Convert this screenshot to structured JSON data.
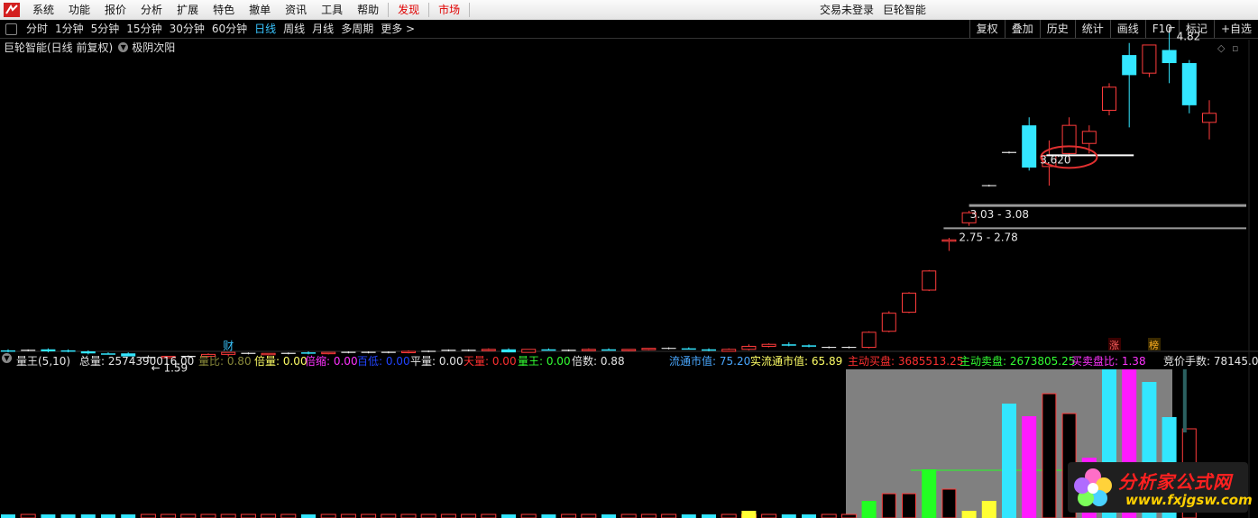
{
  "menu": {
    "items": [
      "系统",
      "功能",
      "报价",
      "分析",
      "扩展",
      "特色",
      "撤单",
      "资讯",
      "工具",
      "帮助"
    ],
    "discover": "发现",
    "market": "市场",
    "login_status": "交易未登录",
    "app_name": "巨轮智能"
  },
  "toolbar": {
    "periods": [
      "分时",
      "1分钟",
      "5分钟",
      "15分钟",
      "30分钟",
      "60分钟",
      "日线",
      "周线",
      "月线",
      "多周期",
      "更多 >"
    ],
    "active_period": "日线",
    "right_buttons": [
      "复权",
      "叠加",
      "历史",
      "统计",
      "画线",
      "F10",
      "标记",
      "+自选"
    ]
  },
  "chart_header": {
    "stock_name": "巨轮智能(日线 前复权)",
    "indicator": "极阴次阳"
  },
  "chart_data": {
    "type": "candlestick",
    "annotations": {
      "high_label": "4.82",
      "low_label": "1.59",
      "circled_label": "3.620",
      "zone_upper": "3.03 - 3.08",
      "zone_lower": "2.75 - 2.78",
      "finance_marker": "财",
      "limit_up_marker": "涨",
      "rank_marker": "榜"
    },
    "ohlc": [
      {
        "o": 1.66,
        "h": 1.67,
        "l": 1.64,
        "c": 1.65
      },
      {
        "o": 1.66,
        "h": 1.67,
        "l": 1.65,
        "c": 1.66
      },
      {
        "o": 1.67,
        "h": 1.68,
        "l": 1.64,
        "c": 1.65
      },
      {
        "o": 1.66,
        "h": 1.67,
        "l": 1.64,
        "c": 1.65
      },
      {
        "o": 1.65,
        "h": 1.66,
        "l": 1.62,
        "c": 1.63
      },
      {
        "o": 1.63,
        "h": 1.64,
        "l": 1.62,
        "c": 1.62
      },
      {
        "o": 1.63,
        "h": 1.64,
        "l": 1.6,
        "c": 1.6
      },
      {
        "o": 1.59,
        "h": 1.61,
        "l": 1.59,
        "c": 1.59
      },
      {
        "o": 1.59,
        "h": 1.6,
        "l": 1.59,
        "c": 1.6
      },
      {
        "o": 1.6,
        "h": 1.61,
        "l": 1.59,
        "c": 1.6
      },
      {
        "o": 1.6,
        "h": 1.63,
        "l": 1.59,
        "c": 1.62
      },
      {
        "o": 1.62,
        "h": 1.64,
        "l": 1.6,
        "c": 1.64
      },
      {
        "o": 1.63,
        "h": 1.64,
        "l": 1.62,
        "c": 1.63
      },
      {
        "o": 1.62,
        "h": 1.63,
        "l": 1.61,
        "c": 1.63
      },
      {
        "o": 1.63,
        "h": 1.64,
        "l": 1.62,
        "c": 1.63
      },
      {
        "o": 1.64,
        "h": 1.65,
        "l": 1.62,
        "c": 1.63
      },
      {
        "o": 1.63,
        "h": 1.64,
        "l": 1.62,
        "c": 1.64
      },
      {
        "o": 1.64,
        "h": 1.65,
        "l": 1.63,
        "c": 1.64
      },
      {
        "o": 1.64,
        "h": 1.65,
        "l": 1.63,
        "c": 1.64
      },
      {
        "o": 1.64,
        "h": 1.65,
        "l": 1.63,
        "c": 1.64
      },
      {
        "o": 1.64,
        "h": 1.66,
        "l": 1.63,
        "c": 1.65
      },
      {
        "o": 1.65,
        "h": 1.66,
        "l": 1.64,
        "c": 1.65
      },
      {
        "o": 1.66,
        "h": 1.67,
        "l": 1.65,
        "c": 1.66
      },
      {
        "o": 1.66,
        "h": 1.67,
        "l": 1.65,
        "c": 1.66
      },
      {
        "o": 1.66,
        "h": 1.68,
        "l": 1.65,
        "c": 1.67
      },
      {
        "o": 1.67,
        "h": 1.68,
        "l": 1.64,
        "c": 1.64
      },
      {
        "o": 1.64,
        "h": 1.67,
        "l": 1.64,
        "c": 1.67
      },
      {
        "o": 1.67,
        "h": 1.68,
        "l": 1.66,
        "c": 1.66
      },
      {
        "o": 1.66,
        "h": 1.67,
        "l": 1.65,
        "c": 1.66
      },
      {
        "o": 1.66,
        "h": 1.68,
        "l": 1.65,
        "c": 1.67
      },
      {
        "o": 1.67,
        "h": 1.68,
        "l": 1.66,
        "c": 1.66
      },
      {
        "o": 1.66,
        "h": 1.67,
        "l": 1.65,
        "c": 1.67
      },
      {
        "o": 1.67,
        "h": 1.68,
        "l": 1.66,
        "c": 1.68
      },
      {
        "o": 1.68,
        "h": 1.69,
        "l": 1.67,
        "c": 1.68
      },
      {
        "o": 1.68,
        "h": 1.69,
        "l": 1.67,
        "c": 1.67
      },
      {
        "o": 1.67,
        "h": 1.68,
        "l": 1.65,
        "c": 1.66
      },
      {
        "o": 1.65,
        "h": 1.68,
        "l": 1.65,
        "c": 1.67
      },
      {
        "o": 1.67,
        "h": 1.72,
        "l": 1.66,
        "c": 1.7
      },
      {
        "o": 1.7,
        "h": 1.73,
        "l": 1.69,
        "c": 1.72
      },
      {
        "o": 1.72,
        "h": 1.74,
        "l": 1.7,
        "c": 1.71
      },
      {
        "o": 1.71,
        "h": 1.72,
        "l": 1.69,
        "c": 1.7
      },
      {
        "o": 1.69,
        "h": 1.7,
        "l": 1.68,
        "c": 1.69
      },
      {
        "o": 1.69,
        "h": 1.7,
        "l": 1.68,
        "c": 1.69
      },
      {
        "o": 1.69,
        "h": 1.85,
        "l": 1.68,
        "c": 1.84
      },
      {
        "o": 1.85,
        "h": 2.05,
        "l": 1.84,
        "c": 2.03
      },
      {
        "o": 2.04,
        "h": 2.24,
        "l": 2.03,
        "c": 2.23
      },
      {
        "o": 2.26,
        "h": 2.46,
        "l": 2.25,
        "c": 2.45
      },
      {
        "o": 2.75,
        "h": 2.78,
        "l": 2.65,
        "c": 2.76
      },
      {
        "o": 2.93,
        "h": 3.05,
        "l": 2.9,
        "c": 3.03
      },
      {
        "o": 3.3,
        "h": 3.31,
        "l": 3.29,
        "c": 3.3
      },
      {
        "o": 3.63,
        "h": 3.64,
        "l": 3.62,
        "c": 3.63
      },
      {
        "o": 3.9,
        "h": 3.98,
        "l": 3.45,
        "c": 3.48
      },
      {
        "o": 3.49,
        "h": 3.75,
        "l": 3.3,
        "c": 3.6
      },
      {
        "o": 3.62,
        "h": 3.98,
        "l": 3.55,
        "c": 3.9
      },
      {
        "o": 3.72,
        "h": 3.9,
        "l": 3.62,
        "c": 3.84
      },
      {
        "o": 4.05,
        "h": 4.32,
        "l": 4.0,
        "c": 4.28
      },
      {
        "o": 4.6,
        "h": 4.72,
        "l": 3.88,
        "c": 4.4
      },
      {
        "o": 4.42,
        "h": 4.7,
        "l": 4.38,
        "c": 4.7
      },
      {
        "o": 4.65,
        "h": 4.82,
        "l": 4.32,
        "c": 4.52
      },
      {
        "o": 4.52,
        "h": 4.55,
        "l": 4.02,
        "c": 4.1
      },
      {
        "o": 3.93,
        "h": 4.15,
        "l": 3.76,
        "c": 4.02
      }
    ]
  },
  "indicator_bar": {
    "name": "量王(5,10)",
    "fields": [
      {
        "label": "总量:",
        "value": "2574390016.00",
        "color": "#e6e6e6"
      },
      {
        "label": "量比:",
        "value": "0.80",
        "color": "#8a8a3a"
      },
      {
        "label": "倍量:",
        "value": "0.00",
        "color": "#ffff66"
      },
      {
        "label": "倍缩:",
        "value": "0.00",
        "color": "#ff33ff"
      },
      {
        "label": "百低:",
        "value": "0.00",
        "color": "#2244ff"
      },
      {
        "label": "平量:",
        "value": "0.00",
        "color": "#e6e6e6"
      },
      {
        "label": "天量:",
        "value": "0.00",
        "color": "#ff3030"
      },
      {
        "label": "量王:",
        "value": "0.00",
        "color": "#33ff33"
      },
      {
        "label": "倍数:",
        "value": "0.88",
        "color": "#e6e6e6"
      },
      {
        "label": "流通市值:",
        "value": "75.20",
        "color": "#4aa8ff"
      },
      {
        "label": "实流通市值:",
        "value": "65.89",
        "color": "#ffff66"
      },
      {
        "label": "主动买盘:",
        "value": "3685513.25",
        "color": "#ff3030"
      },
      {
        "label": "主动卖盘:",
        "value": "2673805.25",
        "color": "#33ff33"
      },
      {
        "label": "买卖盘比:",
        "value": "1.38",
        "color": "#ff33ff"
      },
      {
        "label": "竞价手数:",
        "value": "78145.00",
        "color": "#e6e6e6"
      }
    ]
  },
  "watermark": {
    "title": "分析家公式网",
    "url": "www.fxjgsw.com"
  },
  "colors": {
    "up": "#ff3b3b",
    "down": "#33e6ff",
    "magenta": "#ff1aff",
    "green": "#22ff22",
    "panel_gray": "#808080"
  }
}
